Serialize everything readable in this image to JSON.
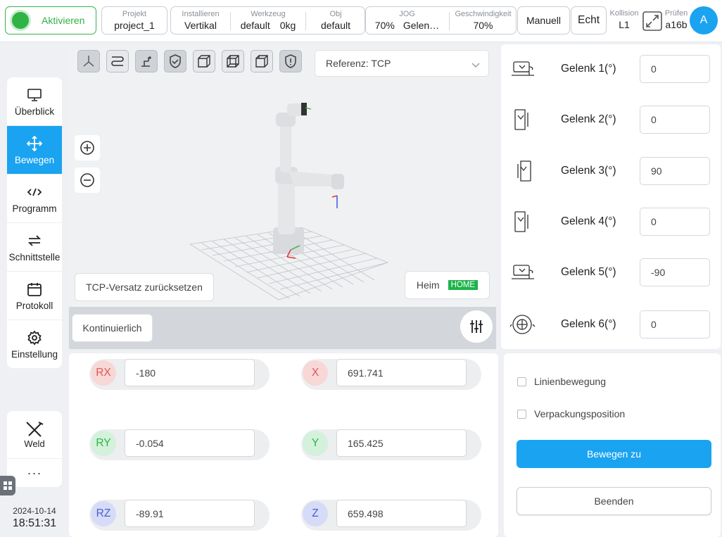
{
  "topbar": {
    "activate_label": "Aktivieren",
    "project": {
      "caption": "Projekt",
      "value": "project_1"
    },
    "install": {
      "caption": "Installieren",
      "value": "Vertikal"
    },
    "tool": {
      "caption": "Werkzeug",
      "value_name": "default",
      "value_mass": "0kg"
    },
    "obj": {
      "caption": "Obj",
      "value": "default"
    },
    "jog": {
      "caption": "JOG",
      "value_pct": "70%",
      "value_mode": "Gelen…"
    },
    "speed": {
      "caption": "Geschwindigkeit",
      "value": "70%"
    },
    "manual_label": "Manuell",
    "real_label": "Echt",
    "collision": {
      "caption": "Kollision",
      "value": "L1"
    },
    "check": {
      "caption": "Prüfen",
      "value": "a16b"
    },
    "avatar_letter": "A"
  },
  "nav": {
    "items": [
      {
        "label": "Überblick",
        "icon": "monitor-icon"
      },
      {
        "label": "Bewegen",
        "icon": "move-arrows-icon"
      },
      {
        "label": "Programm",
        "icon": "code-icon"
      },
      {
        "label": "Schnittstelle",
        "icon": "swap-arrows-icon"
      },
      {
        "label": "Protokoll",
        "icon": "calendar-icon"
      },
      {
        "label": "Einstellung",
        "icon": "gear-icon"
      }
    ],
    "weld_label": "Weld",
    "more_label": "···"
  },
  "clock": {
    "date": "2024-10-14",
    "time": "18:51:31"
  },
  "viewport": {
    "reference_label": "Referenz: TCP",
    "reset_tcp_label": "TCP-Versatz zurücksetzen",
    "home_label": "Heim",
    "home_badge": "HOME",
    "continuous_label": "Kontinuierlich"
  },
  "joints": [
    {
      "label": "Gelenk 1(°)",
      "value": "0"
    },
    {
      "label": "Gelenk 2(°)",
      "value": "0"
    },
    {
      "label": "Gelenk 3(°)",
      "value": "90"
    },
    {
      "label": "Gelenk 4(°)",
      "value": "0"
    },
    {
      "label": "Gelenk 5(°)",
      "value": "-90"
    },
    {
      "label": "Gelenk 6(°)",
      "value": "0"
    }
  ],
  "coords": {
    "rx": {
      "label": "RX",
      "value": "-180"
    },
    "ry": {
      "label": "RY",
      "value": "-0.054"
    },
    "rz": {
      "label": "RZ",
      "value": "-89.91"
    },
    "x": {
      "label": "X",
      "value": "691.741"
    },
    "y": {
      "label": "Y",
      "value": "165.425"
    },
    "z": {
      "label": "Z",
      "value": "659.498"
    }
  },
  "move": {
    "linear_label": "Linienbewegung",
    "packing_label": "Verpackungsposition",
    "move_to_label": "Bewegen zu",
    "quit_label": "Beenden"
  },
  "colors": {
    "accent": "#1aa3f0",
    "active_green": "#2fb344",
    "home_badge": "#1db34a"
  }
}
